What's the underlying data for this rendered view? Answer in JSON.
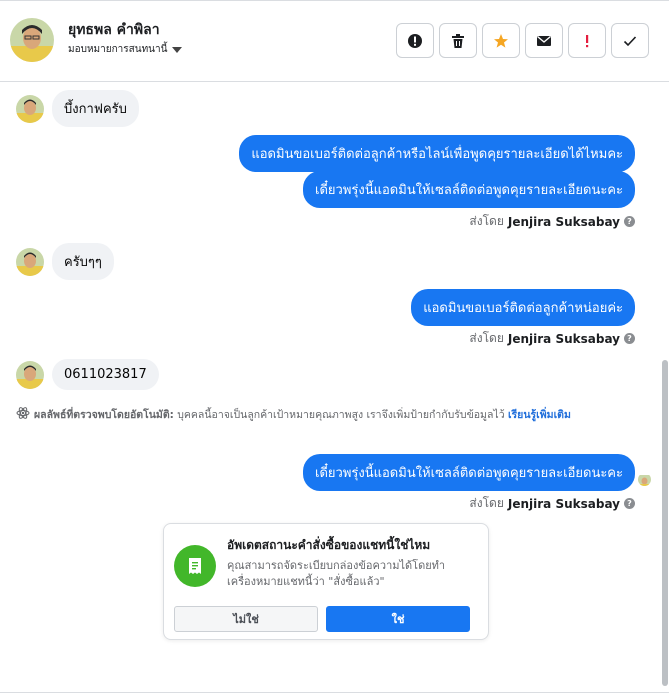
{
  "header": {
    "contact_name": "ยุทธพล คำพิลา",
    "assign_label": "มอบหมายการสนทนานี้",
    "actions": [
      {
        "icon": "exclamation-circle-icon",
        "color": "#1c1e21"
      },
      {
        "icon": "trash-icon",
        "color": "#1c1e21"
      },
      {
        "icon": "star-icon",
        "color": "#f5a623"
      },
      {
        "icon": "envelope-icon",
        "color": "#1c1e21"
      },
      {
        "icon": "exclamation-icon",
        "color": "#e41e3f"
      },
      {
        "icon": "check-icon",
        "color": "#1c1e21"
      }
    ]
  },
  "messages": {
    "in_1": "บึ้งกาฟครับ",
    "out_1": "แอดมินขอเบอร์ติดต่อลูกค้าหรือไลน์เพื่อพูดคุยรายละเอียดได้ไหมคะ",
    "out_2": "เดี๋ยวพรุ่งนี้แอดมินให้เซลล์ติดต่อพูดคุยรายละเอียดนะคะ",
    "sent_by_1_prefix": "ส่งโดย",
    "sent_by_1_name": "Jenjira Suksabay",
    "in_2": "ครับๆๆ",
    "out_3": "แอดมินขอเบอร์ติดต่อลูกค้าหน่อยค่ะ",
    "sent_by_2_prefix": "ส่งโดย",
    "sent_by_2_name": "Jenjira Suksabay",
    "in_3": "0611023817",
    "auto_label": "ผลลัพธ์ที่ตรวจพบโดยอัตโนมัติ:",
    "auto_text": "บุคคลนี้อาจเป็นลูกค้าเป้าหมายคุณภาพสูง เราจึงเพิ่มป้ายกำกับรับข้อมูลไว้",
    "auto_link": "เรียนรู้เพิ่มเติม",
    "out_4": "เดี๋ยวพรุ่งนี้แอดมินให้เซลล์ติดต่อพูดคุยรายละเอียดนะคะ",
    "sent_by_3_prefix": "ส่งโดย",
    "sent_by_3_name": "Jenjira Suksabay",
    "help_glyph": "?"
  },
  "order_card": {
    "title": "อัพเดตสถานะคำสั่งซื้อของแชทนี้ใช่ไหม",
    "body": "คุณสามารถจัดระเบียบกล่องข้อความได้โดยทำเครื่องหมายแชทนี้ว่า \"สั่งซื้อแล้ว\"",
    "no_label": "ไม่ใช่",
    "yes_label": "ใช่",
    "icon": "receipt-icon",
    "icon_bg": "#42b72a"
  },
  "colors": {
    "outgoing_bubble": "#1877f2",
    "incoming_bubble": "#f0f2f5"
  }
}
